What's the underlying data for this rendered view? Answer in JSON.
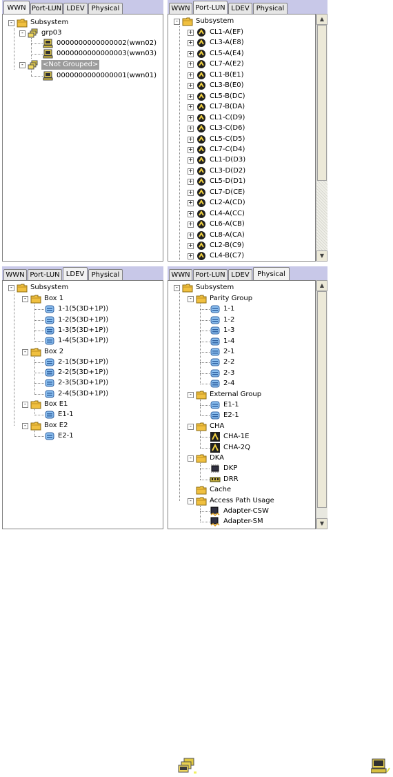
{
  "tabs": [
    "WWN",
    "Port-LUN",
    "LDEV",
    "Physical"
  ],
  "wwn": {
    "root": "Subsystem",
    "group": "grp03",
    "group_items": [
      "0000000000000002(wwn02)",
      "0000000000000003(wwn03)"
    ],
    "ungrouped": "<Not Grouped>",
    "ungrouped_items": [
      "0000000000000001(wwn01)"
    ]
  },
  "portlun": {
    "root": "Subsystem",
    "ports": [
      "CL1-A(EF)",
      "CL3-A(E8)",
      "CL5-A(E4)",
      "CL7-A(E2)",
      "CL1-B(E1)",
      "CL3-B(E0)",
      "CL5-B(DC)",
      "CL7-B(DA)",
      "CL1-C(D9)",
      "CL3-C(D6)",
      "CL5-C(D5)",
      "CL7-C(D4)",
      "CL1-D(D3)",
      "CL3-D(D2)",
      "CL5-D(D1)",
      "CL7-D(CE)",
      "CL2-A(CD)",
      "CL4-A(CC)",
      "CL6-A(CB)",
      "CL8-A(CA)",
      "CL2-B(C9)",
      "CL4-B(C7)"
    ]
  },
  "ldev": {
    "root": "Subsystem",
    "boxes": [
      {
        "name": "Box 1",
        "items": [
          "1-1(5(3D+1P))",
          "1-2(5(3D+1P))",
          "1-3(5(3D+1P))",
          "1-4(5(3D+1P))"
        ]
      },
      {
        "name": "Box 2",
        "items": [
          "2-1(5(3D+1P))",
          "2-2(5(3D+1P))",
          "2-3(5(3D+1P))",
          "2-4(5(3D+1P))"
        ]
      },
      {
        "name": "Box E1",
        "items": [
          "E1-1"
        ]
      },
      {
        "name": "Box E2",
        "items": [
          "E2-1"
        ]
      }
    ]
  },
  "physical": {
    "root": "Subsystem",
    "parity_group": "Parity Group",
    "parity_items": [
      "1-1",
      "1-2",
      "1-3",
      "1-4",
      "2-1",
      "2-2",
      "2-3",
      "2-4"
    ],
    "external_group": "External Group",
    "external_items": [
      "E1-1",
      "E2-1"
    ],
    "cha": "CHA",
    "cha_items": [
      "CHA-1E",
      "CHA-2Q"
    ],
    "dka": "DKA",
    "dka_items": [
      "DKP",
      "DRR"
    ],
    "cache": "Cache",
    "access": "Access Path Usage",
    "access_items": [
      "Adapter-CSW",
      "Adapter-SM"
    ]
  },
  "icons": [
    "folder-icon",
    "group-icon",
    "host-icon",
    "port-icon",
    "volume-icon",
    "cha-icon",
    "chip-icon",
    "memory-icon",
    "adapter-icon"
  ],
  "colors": {
    "tabbar": "#c8c8e8",
    "folder": "#f0c040",
    "volume": "#6aa0d8",
    "selection": "#9c9c9c"
  }
}
